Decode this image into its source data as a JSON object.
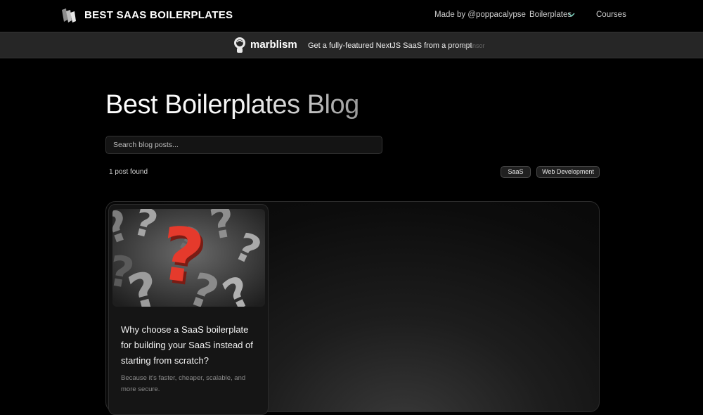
{
  "nav": {
    "brand": "BEST SAAS BOILERPLATES",
    "made_by": "Made by @poppacalypse",
    "boilerplates": "Boilerplates",
    "courses": "Courses"
  },
  "sponsor": {
    "name": "marblism",
    "text": "Get a fully-featured NextJS SaaS from a prompt",
    "tag": "Sponsor"
  },
  "page": {
    "title": "Best Boilerplates Blog",
    "search_placeholder": "Search blog posts...",
    "count": "1 post found",
    "tags": [
      "SaaS",
      "Web Development"
    ]
  },
  "posts": [
    {
      "title_lines": [
        "Why choose a SaaS boilerplate",
        "for building your SaaS instead of",
        "starting from scratch?"
      ],
      "desc_lines": [
        "Because it's faster, cheaper, scalable, and",
        "more secure."
      ]
    }
  ],
  "colors": {
    "background": "#000000",
    "sponsor_bar": "#262626",
    "accent_chevron": "#7fd6c2",
    "question_mark_red": "#e53a2c"
  }
}
